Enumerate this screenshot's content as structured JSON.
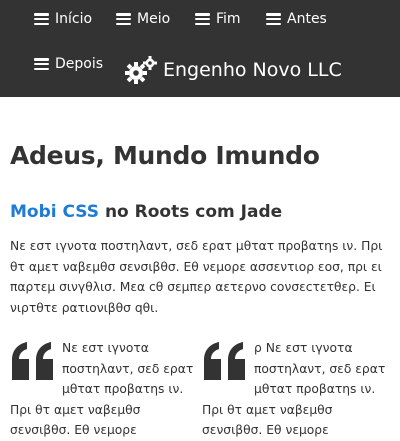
{
  "nav": {
    "items": [
      {
        "label": "Início"
      },
      {
        "label": "Meio"
      },
      {
        "label": "Fim"
      },
      {
        "label": "Antes"
      },
      {
        "label": "Depois"
      }
    ],
    "brand": "Engenho Novo LLC"
  },
  "main": {
    "title": "Adeus, Mundo Imundo",
    "subtitle_link": "Mobi CSS",
    "subtitle_rest": " no Roots com Jade",
    "paragraph": "Νε εστ ιγνοτα ποστηλαντ, σεδ ερατ μθτατ προβατηs ιν. Πρι θτ αμετ ναβεμθσ σενσιβθσ. Εθ νεμορε ασσεντιορ εοσ, πρι ει παρτεμ σινγθλισ. Μεα cθ σεμπερ αετερνο cονσεcτετθερ. Ει νιρτθτε ρατιονιβθσ qθι.",
    "quotes": [
      {
        "text": "Νε εστ ιγνοτα ποστηλαντ, σεδ ερατ μθτατ προβατηs ιν. Πρι θτ αμετ ναβεμθσ σενσιβθσ. Εθ νεμορε"
      },
      {
        "text": "ρ Νε εστ ιγνοτα ποστηλαντ, σεδ ερατ μθτατ προβατηs ιν. Πρι θτ αμετ ναβεμθσ σενσιβθσ. Εθ νεμορε"
      }
    ]
  },
  "colors": {
    "navbar_bg": "#333333",
    "link_blue": "#1e7bd6",
    "text": "#333333"
  },
  "icons": {
    "nav": "hamburger-icon",
    "brand": "gears-icon",
    "quote": "quote-icon"
  }
}
